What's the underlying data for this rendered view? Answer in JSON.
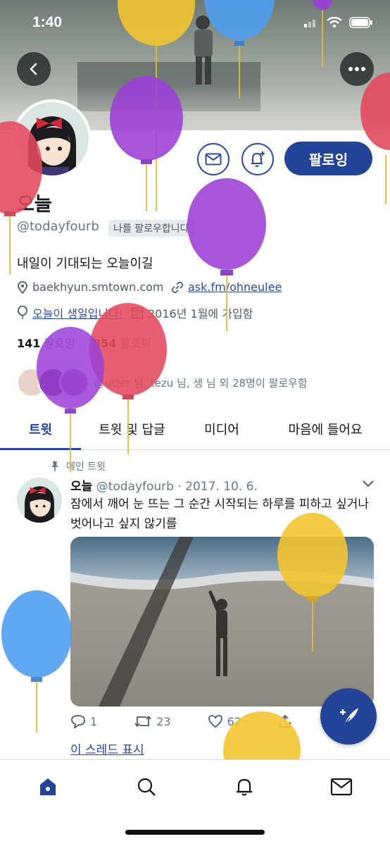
{
  "status_bar": {
    "time": "1:40"
  },
  "profile": {
    "follow_label": "팔로잉",
    "name": "오늘",
    "handle": "@todayfourb",
    "follows_you": "나를 팔로우합니다",
    "bio": "내일이 기대되는 오늘이길",
    "website": "baekhyun.smtown.com",
    "link": "ask.fm/ohneulee",
    "birthday": "오늘이 생일입니다!",
    "joined": "2016년 1월에 가입함",
    "following_count": "141",
    "following_label": "팔로잉",
    "followers_count": "854",
    "followers_label": "팔로워",
    "followed_by": "@utter 님, tezu 님, 생 님 외 28명이 팔로우함"
  },
  "tabs": [
    {
      "label": "트윗"
    },
    {
      "label": "트윗 및 답글"
    },
    {
      "label": "미디어"
    },
    {
      "label": "마음에 들어요"
    }
  ],
  "tweet": {
    "pinned_label": "메인 트윗",
    "name": "오늘",
    "handle_date": "@todayfourb · 2017. 10. 6.",
    "text": "잠에서 깨어 눈 뜨는 그 순간 시작되는 하루를 피하고 싶거나 벗어나고 싶지 않기를",
    "replies": "1",
    "retweets": "23",
    "likes": "62",
    "show_thread": "이 스레드 표시"
  },
  "colors": {
    "brand": "#24449a",
    "balloon_red": "#e24a5e",
    "balloon_purple": "#9b3fd8",
    "balloon_yellow": "#f2c531",
    "balloon_blue": "#4f9ff0"
  }
}
